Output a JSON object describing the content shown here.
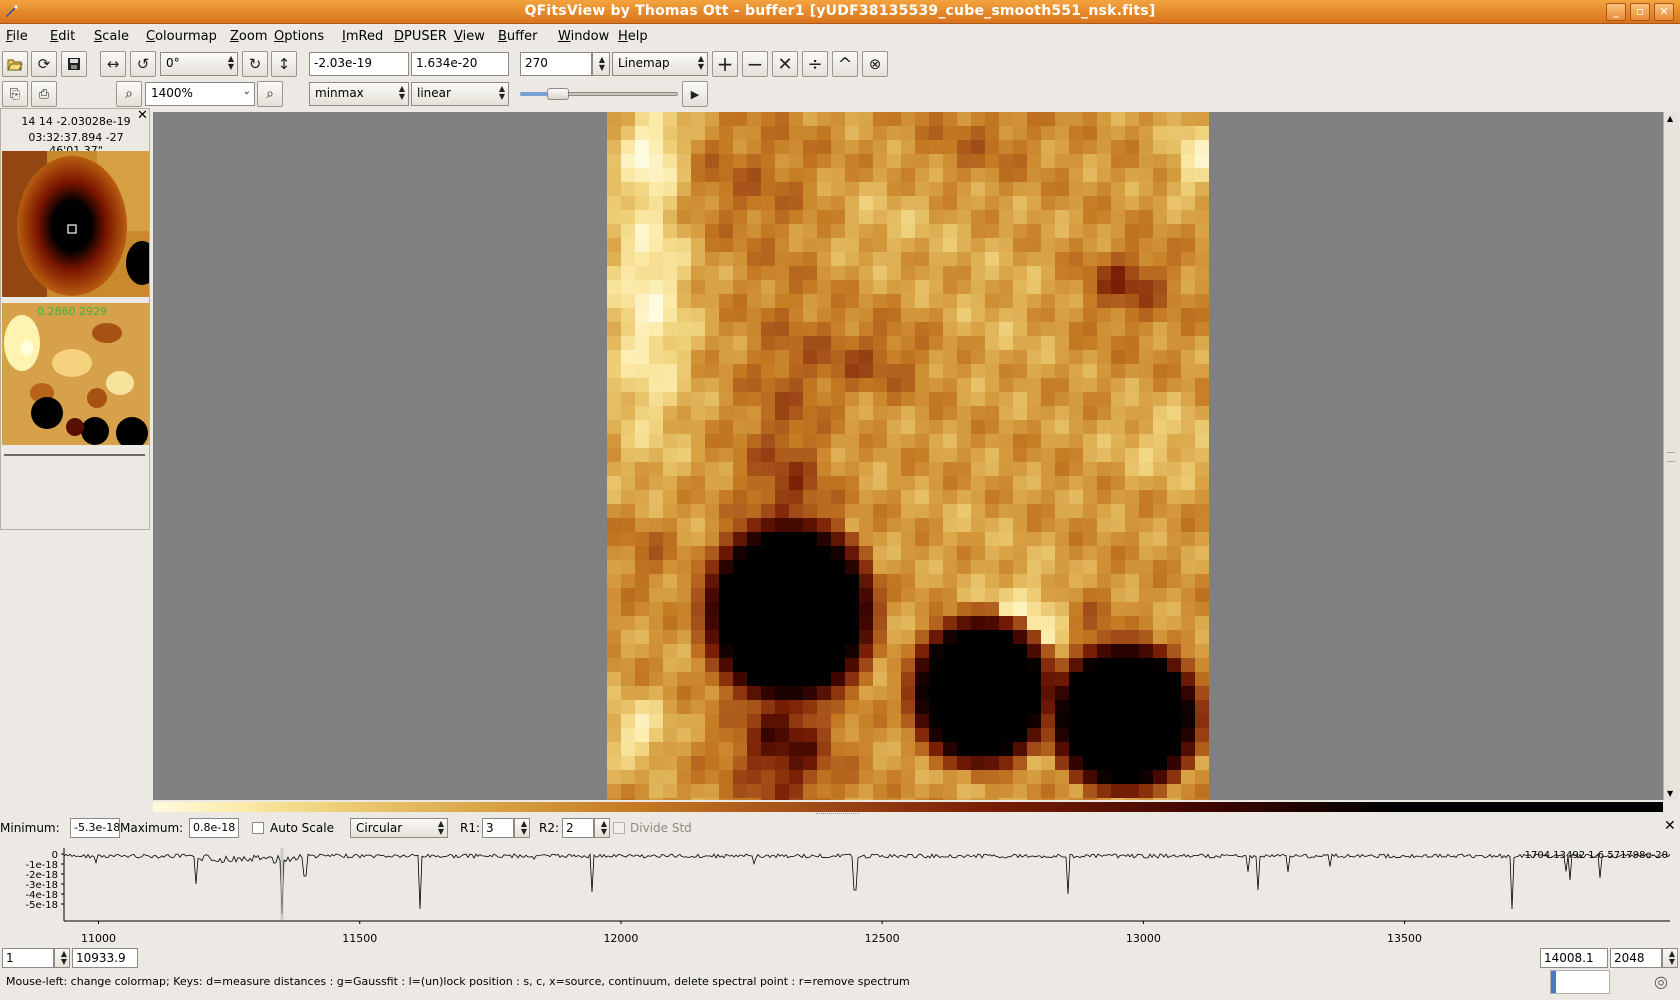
{
  "window": {
    "title": "QFitsView by Thomas Ott - buffer1 [yUDF38135539_cube_smooth551_nsk.fits]"
  },
  "menu": [
    {
      "u": "F",
      "rest": "ile"
    },
    {
      "u": "E",
      "rest": "dit"
    },
    {
      "u": "S",
      "rest": "cale"
    },
    {
      "u": "C",
      "rest": "olourmap"
    },
    {
      "u": "Z",
      "rest": "oom"
    },
    {
      "u": "O",
      "rest": "ptions"
    },
    {
      "u": "I",
      "rest": "mRed"
    },
    {
      "u": "D",
      "rest": "PUSER"
    },
    {
      "u": "V",
      "rest": "iew"
    },
    {
      "u": "B",
      "rest": "uffer"
    },
    {
      "u": "W",
      "rest": "indow"
    },
    {
      "u": "H",
      "rest": "elp"
    }
  ],
  "toolbar": {
    "rotation": "0°",
    "min_value": "-2.03e-19",
    "max_value": "1.634e-20",
    "channel": "270",
    "mode": "Linemap",
    "zoom": "1400%",
    "scale_mode": "minmax",
    "scale_type": "linear",
    "slider_fraction": 0.2
  },
  "left_panel": {
    "coord_line1": "14 14 -2.03028e-19",
    "coord_line2": "03:32:37.894 -27 46'01.37\"",
    "overview_label": "0.2860 2929",
    "close_label": "✕"
  },
  "spectrum_controls": {
    "minimum_label": "Minimum:",
    "minimum_value": "-5.3e-18",
    "maximum_label": "Maximum:",
    "maximum_value": "0.8e-18",
    "autoscale_label": "Auto Scale",
    "aperture": "Circular",
    "r1_label": "R1:",
    "r1_value": "3",
    "r2_label": "R2:",
    "r2_value": "2",
    "dividestd_label": "Divide Std",
    "close_label": "✕"
  },
  "spectrum": {
    "y_ticks": [
      "0",
      "-1e-18",
      "-2e-18",
      "-3e-18",
      "-4e-18",
      "-5e-18"
    ],
    "x_ticks": [
      "11000",
      "11500",
      "12000",
      "12500",
      "13000",
      "13500"
    ],
    "readout": "1704.13492 1.6 571798e-20"
  },
  "bottom": {
    "left_spin": "1",
    "left_value": "10933.9",
    "right_value": "14008.1",
    "right_spin": "2048"
  },
  "status": {
    "text": "Mouse-left: change colormap; Keys: d=measure distances : g=Gaussfit : l=(un)lock position : s, c, x=source, continuum, delete spectral point : r=remove spectrum"
  },
  "colors": {
    "title_orange": "#e4862a",
    "viewer_grey": "#808080",
    "label_green": "#3db53d"
  }
}
